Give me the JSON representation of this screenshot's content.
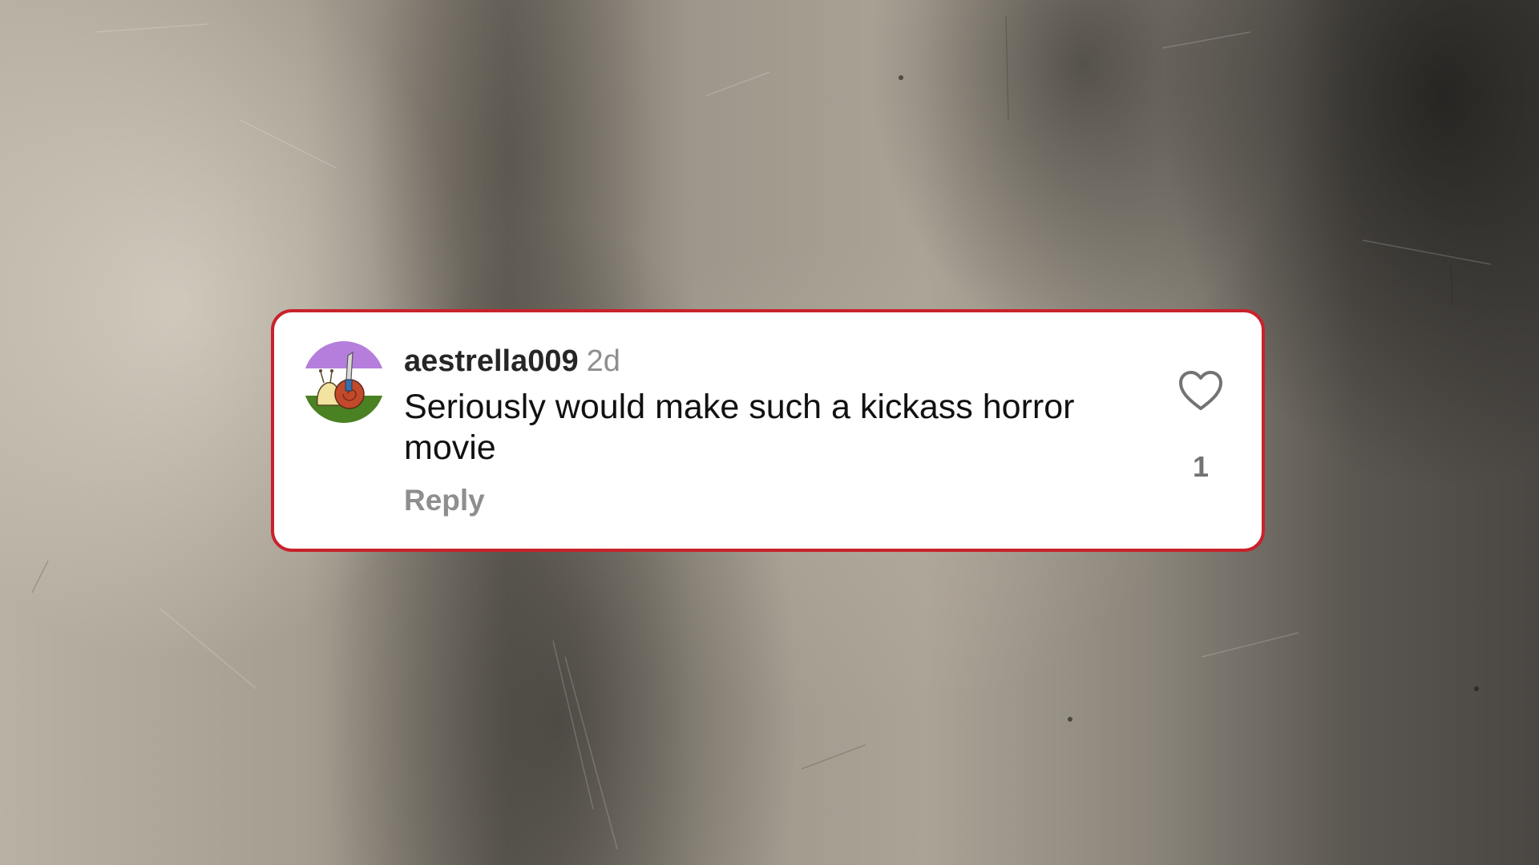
{
  "comment": {
    "username": "aestrella009",
    "timestamp": "2d",
    "text": "Seriously would make such a kickass horror movie",
    "reply_label": "Reply",
    "like_count": "1",
    "avatar_icon": "snail-with-knife-avatar",
    "like_icon": "heart-outline-icon"
  },
  "colors": {
    "card_border": "#c8222b",
    "card_background": "#ffffff",
    "username": "#262626",
    "secondary_text": "#8e8e8e",
    "avatar_top_stripe": "#b57edc",
    "avatar_middle_stripe": "#ffffff",
    "avatar_bottom_stripe": "#4a8123"
  }
}
